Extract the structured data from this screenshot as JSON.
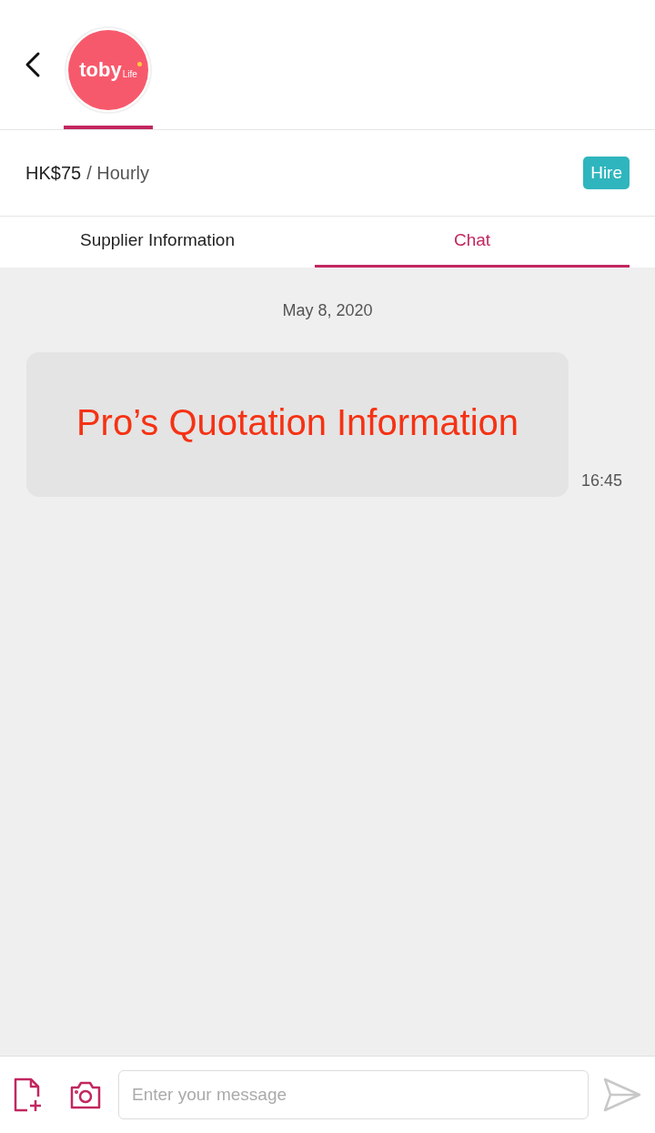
{
  "header": {
    "logo": {
      "word": "toby",
      "suffix": "Life"
    },
    "logo_selected": true
  },
  "price": {
    "amount": "HK$75",
    "unit": "/ Hourly",
    "action": "Hire"
  },
  "tabs": [
    {
      "label": "Supplier Information",
      "selected": false
    },
    {
      "label": "Chat",
      "selected": true
    }
  ],
  "chat": {
    "date": "May 8, 2020",
    "messages": [
      {
        "text": "Pro’s Quotation Information",
        "time": "16:45"
      }
    ]
  },
  "composer": {
    "placeholder": "Enter your message"
  }
}
